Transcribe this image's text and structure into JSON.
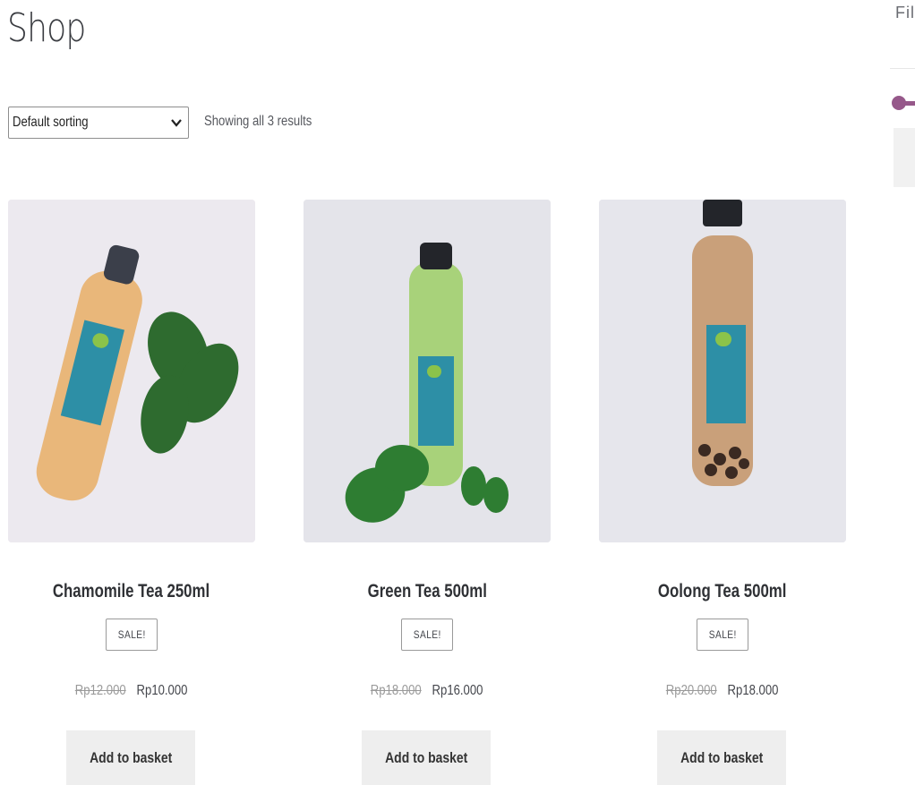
{
  "page": {
    "title": "Shop"
  },
  "toolbar": {
    "sort_selected": "Default sorting",
    "result_count": "Showing all 3 results"
  },
  "products": [
    {
      "name": "Chamomile Tea 250ml",
      "badge": "SALE!",
      "old_price": "Rp12.000",
      "price": "Rp10.000",
      "button": "Add to basket",
      "liquid_color": "#e9b77a"
    },
    {
      "name": "Green Tea 500ml",
      "badge": "SALE!",
      "old_price": "Rp18.000",
      "price": "Rp16.000",
      "button": "Add to basket",
      "liquid_color": "#9fcc6a"
    },
    {
      "name": "Oolong Tea 500ml",
      "badge": "SALE!",
      "old_price": "Rp20.000",
      "price": "Rp18.000",
      "button": "Add to basket",
      "liquid_color": "#c9a07a"
    }
  ],
  "sidebar": {
    "heading": "Fil",
    "accent_color": "#96588a"
  }
}
